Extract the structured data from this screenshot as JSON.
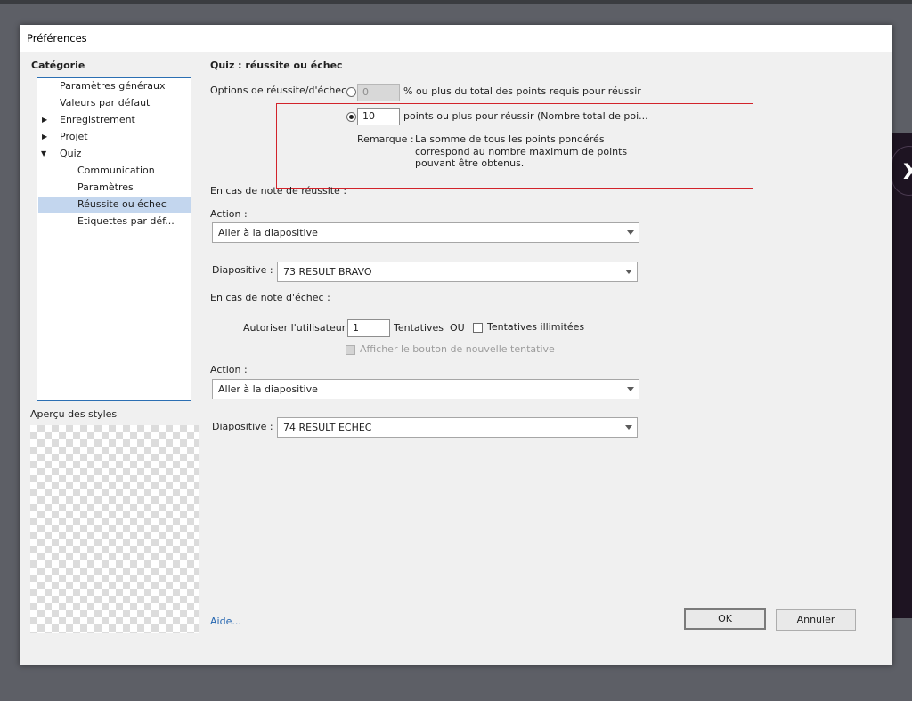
{
  "window": {
    "title": "Préférences"
  },
  "category": {
    "heading": "Catégorie",
    "items": [
      {
        "label": "Paramètres généraux"
      },
      {
        "label": "Valeurs par défaut"
      },
      {
        "label": "Enregistrement",
        "expander": "collapsed"
      },
      {
        "label": "Projet",
        "expander": "collapsed"
      },
      {
        "label": "Quiz",
        "expander": "expanded"
      },
      {
        "label": "Communication"
      },
      {
        "label": "Paramètres"
      },
      {
        "label": "Réussite ou échec",
        "selected": true
      },
      {
        "label": "Etiquettes par déf..."
      }
    ]
  },
  "style_preview": {
    "label": "Aperçu des styles"
  },
  "panel": {
    "title": "Quiz : réussite ou échec",
    "options_label": "Options de réussite/d'échec :",
    "percent_value": "0",
    "percent_text": "% ou plus du total des points requis pour réussir",
    "points_value": "10",
    "points_text": "points ou plus pour réussir (Nombre total de poi...",
    "remark_label": "Remarque :",
    "remark_lines": [
      "La somme de tous les points pondérés",
      "correspond au nombre maximum de points",
      "pouvant être obtenus."
    ],
    "pass_section": "En cas de note de réussite :",
    "pass_action_label": "Action :",
    "pass_action_value": "Aller à la diapositive",
    "pass_slide_label": "Diapositive :",
    "pass_slide_value": "73 RESULT BRAVO",
    "fail_section": "En cas de note d'échec :",
    "allow_user_label": "Autoriser l'utilisateur :",
    "attempts_value": "1",
    "attempts_label": "Tentatives",
    "or_label": "OU",
    "unlimited_label": "Tentatives illimitées",
    "retry_button_label": "Afficher le bouton de nouvelle tentative",
    "fail_action_label": "Action :",
    "fail_action_value": "Aller à la diapositive",
    "fail_slide_label": "Diapositive :",
    "fail_slide_value": "74 RESULT ECHEC"
  },
  "footer": {
    "help_link": "Aide...",
    "ok_label": "OK",
    "cancel_label": "Annuler"
  },
  "colors": {
    "selection": "#c3d6ee",
    "list_border": "#2b6fb3",
    "highlight": "#d2232a",
    "link": "#2566b0"
  }
}
